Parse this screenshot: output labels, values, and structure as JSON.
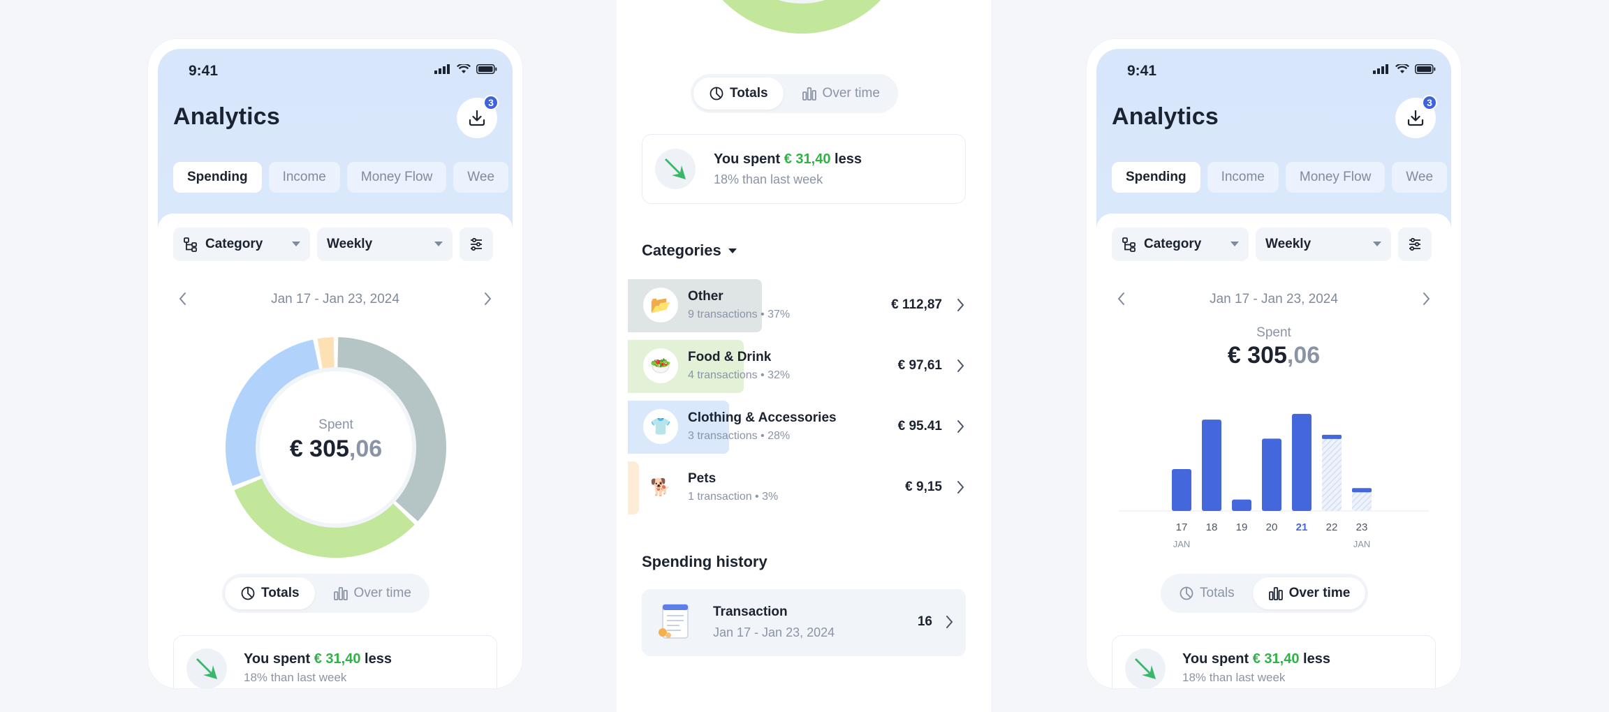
{
  "status": {
    "time": "9:41"
  },
  "header": {
    "title": "Analytics",
    "download_badge": "3"
  },
  "tabs": [
    {
      "label": "Spending"
    },
    {
      "label": "Income"
    },
    {
      "label": "Money Flow"
    },
    {
      "label": "Wee"
    }
  ],
  "filters": {
    "group_by": "Category",
    "period": "Weekly"
  },
  "date_range": "Jan 17 - Jan 23, 2024",
  "spent": {
    "label": "Spent",
    "currency": "€ 305",
    "cents": ",06"
  },
  "segmented": {
    "totals": "Totals",
    "over_time": "Over time"
  },
  "insight": {
    "prefix": "You spent",
    "amount": "€ 31,40",
    "suffix": "less",
    "detail": "18% than last week",
    "detail_partial": "18% than last week"
  },
  "categories_header": "Categories",
  "categories": [
    {
      "name": "Other",
      "sub": "9 transactions • 37%",
      "amount": "€ 112,87",
      "icon": "folder-icon",
      "share": 37,
      "color": "#dfe5e5"
    },
    {
      "name": "Food & Drink",
      "sub": "4 transactions • 32%",
      "amount": "€ 97,61",
      "icon": "salad-icon",
      "share": 32,
      "color": "#e3f1d6"
    },
    {
      "name": "Clothing & Accessories",
      "sub": "3 transactions • 28%",
      "amount": "€ 95.41",
      "icon": "shirt-icon",
      "share": 28,
      "color": "#d9e8fb"
    },
    {
      "name": "Pets",
      "sub": "1 transaction • 3%",
      "amount": "€ 9,15",
      "icon": "dog-icon",
      "share": 3,
      "color": "#fdecd6"
    }
  ],
  "history": {
    "header": "Spending history",
    "item_title": "Transaction",
    "item_date": "Jan 17 - Jan 23, 2024",
    "item_count": "16"
  },
  "donut": {
    "segments": [
      {
        "name": "Other",
        "value": 37,
        "color": "#b5c5c5"
      },
      {
        "name": "Food & Drink",
        "value": 32,
        "color": "#c2e79a"
      },
      {
        "name": "Clothing & Accessories",
        "value": 28,
        "color": "#b1d2fb"
      },
      {
        "name": "Pets",
        "value": 3,
        "color": "#fde0b3"
      }
    ]
  },
  "chart_data": {
    "type": "bar",
    "categories": [
      "17",
      "18",
      "19",
      "20",
      "21",
      "22",
      "23"
    ],
    "month_labels": [
      "JAN",
      "",
      "",
      "",
      "",
      "",
      "JAN"
    ],
    "values": [
      22,
      48,
      6,
      38,
      51,
      40,
      12
    ],
    "projected": [
      false,
      false,
      false,
      false,
      false,
      true,
      true
    ],
    "highlight": "21",
    "bar_color": "#4468dc",
    "ylim": [
      0,
      55
    ]
  }
}
